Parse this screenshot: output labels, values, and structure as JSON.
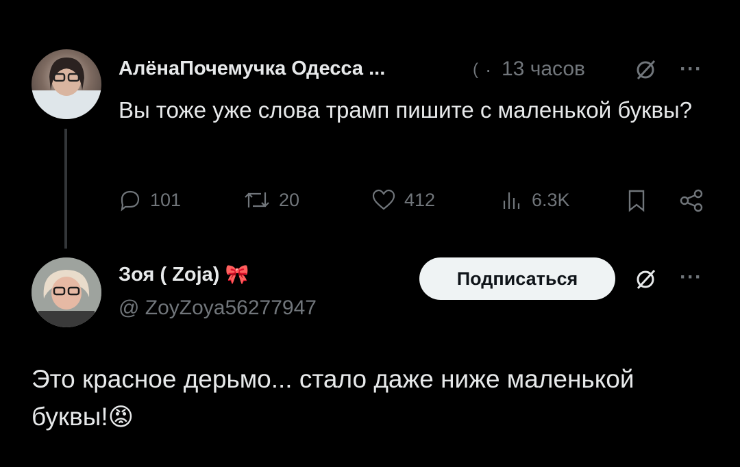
{
  "tweet1": {
    "author": "АлёнаПочемучка Одесса ...",
    "meta_dot": "·",
    "time": "13 часов",
    "more": "···",
    "text": "Вы тоже уже слова трамп  пишите с маленькой буквы?",
    "actions": {
      "replies": "101",
      "retweets": "20",
      "likes": "412",
      "views": "6.3K"
    }
  },
  "tweet2": {
    "author": "Зоя ( Zoja)",
    "author_emoji": "🎀",
    "handle": "@ ZoyZoya56277947",
    "follow_label": "Подписаться",
    "more": "···",
    "text": "Это красное дерьмо... стало даже ниже маленькой буквы!",
    "text_emoji": "😡"
  },
  "colors": {
    "background": "#000000",
    "text": "#e7e9ea",
    "muted": "#71767b",
    "follow_bg": "#eff3f4"
  },
  "icons": [
    "reply-icon",
    "retweet-icon",
    "like-icon",
    "views-icon",
    "bookmark-icon",
    "share-icon",
    "grok-icon",
    "community-icon"
  ]
}
